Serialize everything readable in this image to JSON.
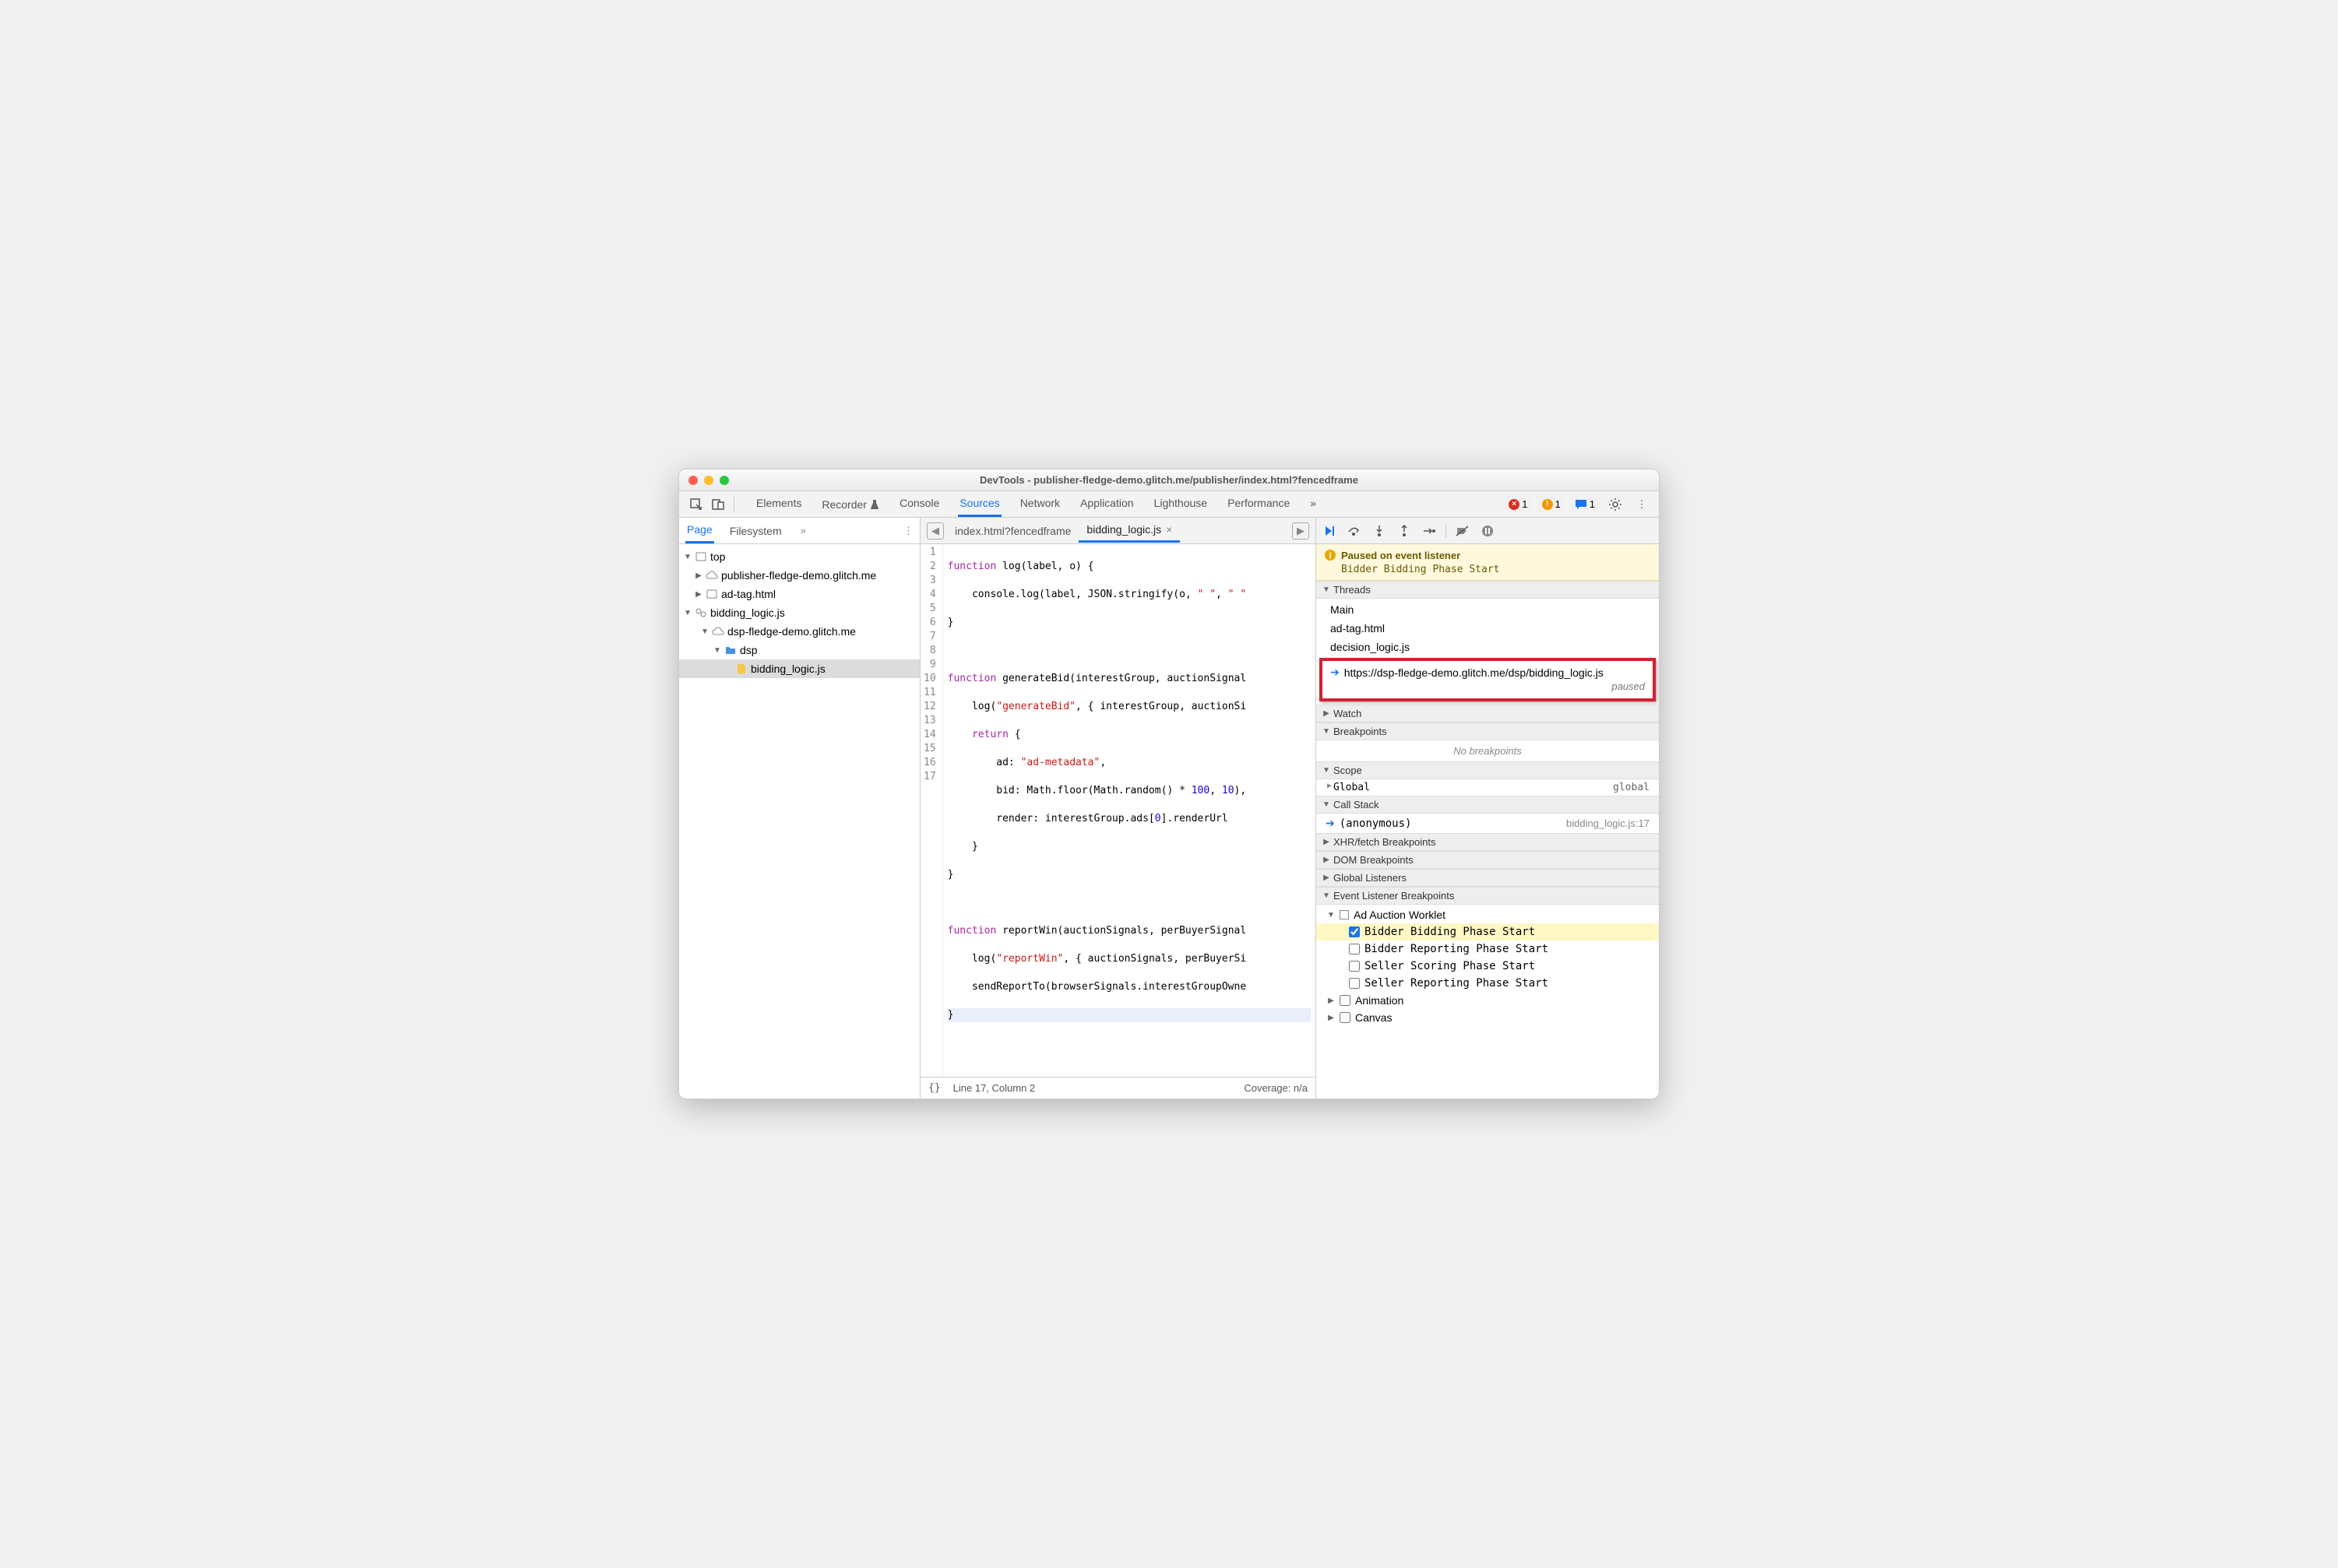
{
  "title": "DevTools - publisher-fledge-demo.glitch.me/publisher/index.html?fencedframe",
  "tabs": [
    "Elements",
    "Recorder",
    "Console",
    "Sources",
    "Network",
    "Application",
    "Lighthouse",
    "Performance"
  ],
  "activeTab": "Sources",
  "errors": "1",
  "warnings": "1",
  "messages": "1",
  "sideTabs": {
    "page": "Page",
    "filesystem": "Filesystem"
  },
  "tree": {
    "top": "top",
    "pub": "publisher-fledge-demo.glitch.me",
    "adtag": "ad-tag.html",
    "bidlogic": "bidding_logic.js",
    "dsp_origin": "dsp-fledge-demo.glitch.me",
    "dsp": "dsp",
    "bidfile": "bidding_logic.js"
  },
  "fileTabs": {
    "t1": "index.html?fencedframe",
    "t2": "bidding_logic.js"
  },
  "code": {
    "l1a": "function",
    "l1b": " log(label, o) {",
    "l2a": "    console.log(label, JSON.stringify(o, ",
    "l2b": "\" \"",
    "l2c": ", ",
    "l2d": "\" \"",
    "l3": "}",
    "l5a": "function",
    "l5b": " generateBid(interestGroup, auctionSignal",
    "l6a": "    log(",
    "l6b": "\"generateBid\"",
    "l6c": ", { interestGroup, auctionSi",
    "l7a": "    ",
    "l7b": "return",
    "l7c": " {",
    "l8a": "        ad: ",
    "l8b": "\"ad-metadata\"",
    "l8c": ",",
    "l9a": "        bid: Math.floor(Math.random() * ",
    "l9b": "100",
    "l9c": ", ",
    "l9d": "10",
    "l9e": "),",
    "l10a": "        render: interestGroup.ads[",
    "l10b": "0",
    "l10c": "].renderUrl",
    "l11": "    }",
    "l12": "}",
    "l14a": "function",
    "l14b": " reportWin(auctionSignals, perBuyerSignal",
    "l15a": "    log(",
    "l15b": "\"reportWin\"",
    "l15c": ", { auctionSignals, perBuyerSi",
    "l16": "    sendReportTo(browserSignals.interestGroupOwne",
    "l17": "}"
  },
  "status": {
    "pos": "Line 17, Column 2",
    "coverage": "Coverage: n/a"
  },
  "paused": {
    "title": "Paused on event listener",
    "detail": "Bidder Bidding Phase Start"
  },
  "sections": {
    "threads": "Threads",
    "watch": "Watch",
    "breakpoints": "Breakpoints",
    "scope": "Scope",
    "callstack": "Call Stack",
    "xhr": "XHR/fetch Breakpoints",
    "dom": "DOM Breakpoints",
    "globals": "Global Listeners",
    "eventbp": "Event Listener Breakpoints"
  },
  "threads": {
    "main": "Main",
    "adtag": "ad-tag.html",
    "decision": "decision_logic.js",
    "bidding_url": "https://dsp-fledge-demo.glitch.me/dsp/bidding_logic.js",
    "paused": "paused"
  },
  "noBreakpoints": "No breakpoints",
  "scope": {
    "global": "Global",
    "globalVal": "global"
  },
  "stack": {
    "fn": "(anonymous)",
    "loc": "bidding_logic.js:17"
  },
  "events": {
    "adworklet": "Ad Auction Worklet",
    "e1": "Bidder Bidding Phase Start",
    "e2": "Bidder Reporting Phase Start",
    "e3": "Seller Scoring Phase Start",
    "e4": "Seller Reporting Phase Start",
    "anim": "Animation",
    "canvas": "Canvas"
  }
}
